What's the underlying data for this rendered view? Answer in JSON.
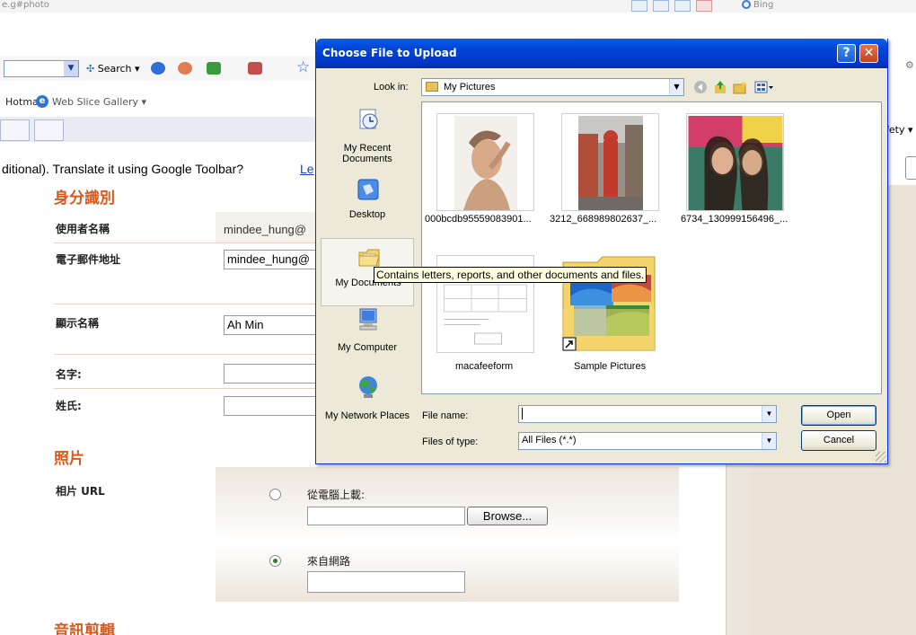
{
  "browser": {
    "url_fragment": "e.g#photo",
    "bing_label": "Bing",
    "search_label": "Search",
    "hotmail_label": "Hotmail",
    "web_slice_label": "Web Slice Gallery",
    "safety_label": "fety",
    "translate_text": "ditional).  Translate it using Google Toolbar?",
    "translate_link": "Le"
  },
  "form": {
    "section_identity": "身分識別",
    "username_label": "使用者名稱",
    "username_value": "mindee_hung@",
    "email_label": "電子郵件地址",
    "email_value": "mindee_hung@",
    "display_name_label": "顯示名稱",
    "display_name_value": "Ah Min",
    "first_name_label": "名字:",
    "last_name_label": "姓氏:",
    "section_photo": "照片",
    "photo_url_label": "相片 URL",
    "upload_option": "從電腦上載:",
    "browse_label": "Browse...",
    "web_option": "來自網路",
    "section_audio": "音訊剪輯"
  },
  "dialog": {
    "title": "Choose File to Upload",
    "help_label": "?",
    "close_label": "✕",
    "look_in_label": "Look in:",
    "look_in_value": "My Pictures",
    "places": [
      {
        "label": "My Recent Documents",
        "icon": "recent-documents-icon"
      },
      {
        "label": "Desktop",
        "icon": "desktop-icon"
      },
      {
        "label": "My Documents",
        "icon": "my-documents-icon"
      },
      {
        "label": "My Computer",
        "icon": "my-computer-icon"
      },
      {
        "label": "My Network Places",
        "icon": "network-places-icon"
      }
    ],
    "files": [
      {
        "name": "000bcdb95559083901...",
        "type": "image"
      },
      {
        "name": "3212_668989802637_...",
        "type": "image"
      },
      {
        "name": "6734_130999156496_...",
        "type": "image"
      },
      {
        "name": "macafeeform",
        "type": "document"
      },
      {
        "name": "Sample Pictures",
        "type": "folder-shortcut"
      }
    ],
    "tooltip": "Contains letters, reports, and other documents and files.",
    "file_name_label": "File name:",
    "file_name_value": "",
    "files_of_type_label": "Files of type:",
    "files_of_type_value": "All Files (*.*)",
    "open_label": "Open",
    "cancel_label": "Cancel"
  },
  "colors": {
    "title_bar": "#0247d9",
    "section_heading": "#d9591c",
    "window_face": "#ece9d8"
  }
}
